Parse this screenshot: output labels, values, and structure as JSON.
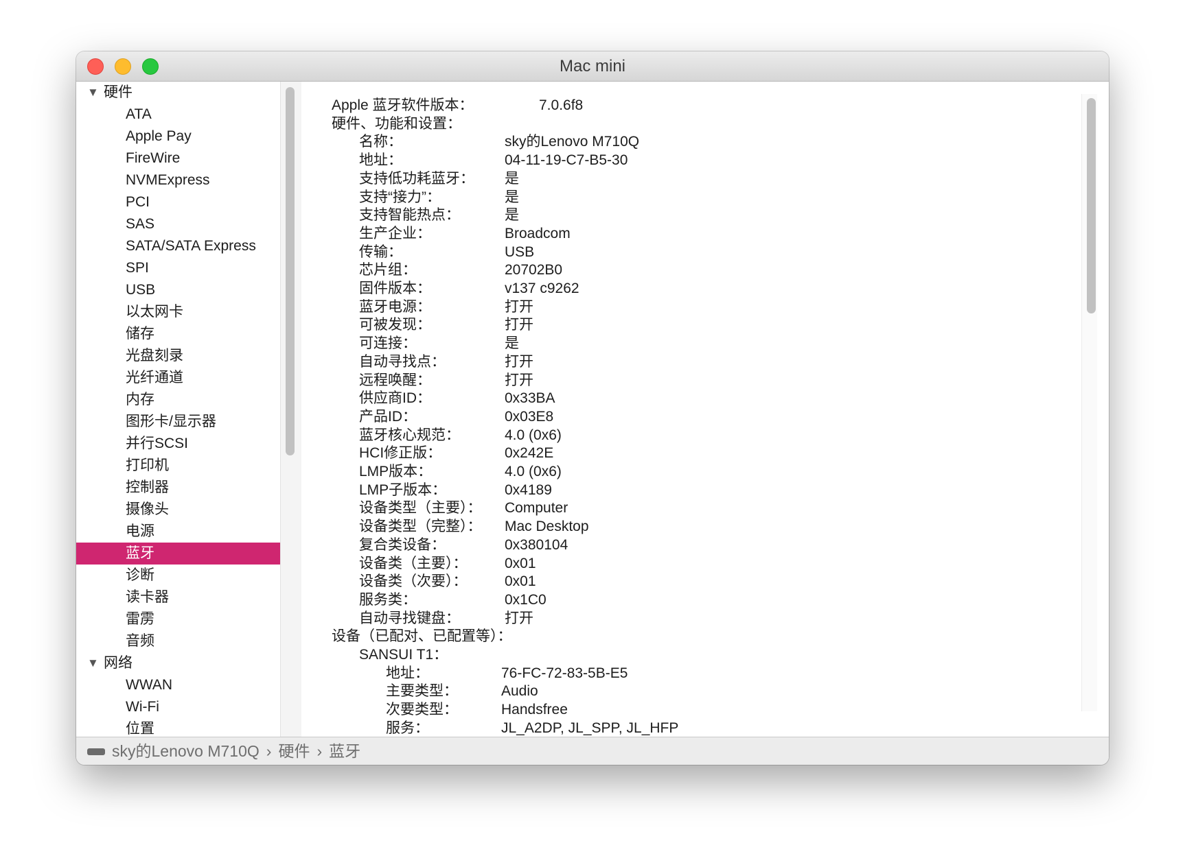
{
  "window": {
    "title": "Mac mini",
    "traffic_lights": {
      "close": "#fe5f57",
      "minimize": "#febc2e",
      "zoom": "#28c840"
    }
  },
  "accent_color": "#cf2670",
  "sidebar": {
    "items": [
      {
        "label": "硬件",
        "group": true,
        "icon": "disclosure-triangle-down"
      },
      {
        "label": "ATA"
      },
      {
        "label": "Apple Pay"
      },
      {
        "label": "FireWire"
      },
      {
        "label": "NVMExpress"
      },
      {
        "label": "PCI"
      },
      {
        "label": "SAS"
      },
      {
        "label": "SATA/SATA Express"
      },
      {
        "label": "SPI"
      },
      {
        "label": "USB"
      },
      {
        "label": "以太网卡"
      },
      {
        "label": "储存"
      },
      {
        "label": "光盘刻录"
      },
      {
        "label": "光纤通道"
      },
      {
        "label": "内存"
      },
      {
        "label": "图形卡/显示器"
      },
      {
        "label": "并行SCSI"
      },
      {
        "label": "打印机"
      },
      {
        "label": "控制器"
      },
      {
        "label": "摄像头"
      },
      {
        "label": "电源"
      },
      {
        "label": "蓝牙",
        "selected": true
      },
      {
        "label": "诊断"
      },
      {
        "label": "读卡器"
      },
      {
        "label": "雷雳"
      },
      {
        "label": "音频"
      },
      {
        "label": "网络",
        "group": true,
        "icon": "disclosure-triangle-down"
      },
      {
        "label": "WWAN"
      },
      {
        "label": "Wi-Fi"
      },
      {
        "label": "位置"
      }
    ]
  },
  "content": {
    "rows": [
      {
        "level": 0,
        "label": "Apple 蓝牙软件版本：",
        "value": "7.0.6f8",
        "wide": true
      },
      {
        "level": 0,
        "label": "硬件、功能和设置：",
        "value": ""
      },
      {
        "level": 1,
        "label": "名称：",
        "value": "sky的Lenovo M710Q"
      },
      {
        "level": 1,
        "label": "地址：",
        "value": "04-11-19-C7-B5-30"
      },
      {
        "level": 1,
        "label": "支持低功耗蓝牙：",
        "value": "是"
      },
      {
        "level": 1,
        "label": "支持“接力”：",
        "value": "是"
      },
      {
        "level": 1,
        "label": "支持智能热点：",
        "value": "是"
      },
      {
        "level": 1,
        "label": "生产企业：",
        "value": "Broadcom"
      },
      {
        "level": 1,
        "label": "传输：",
        "value": "USB"
      },
      {
        "level": 1,
        "label": "芯片组：",
        "value": "20702B0"
      },
      {
        "level": 1,
        "label": "固件版本：",
        "value": "v137 c9262"
      },
      {
        "level": 1,
        "label": "蓝牙电源：",
        "value": "打开"
      },
      {
        "level": 1,
        "label": "可被发现：",
        "value": "打开"
      },
      {
        "level": 1,
        "label": "可连接：",
        "value": "是"
      },
      {
        "level": 1,
        "label": "自动寻找点：",
        "value": "打开"
      },
      {
        "level": 1,
        "label": "远程唤醒：",
        "value": "打开"
      },
      {
        "level": 1,
        "label": "供应商ID：",
        "value": "0x33BA"
      },
      {
        "level": 1,
        "label": "产品ID：",
        "value": "0x03E8"
      },
      {
        "level": 1,
        "label": "蓝牙核心规范：",
        "value": "4.0 (0x6)"
      },
      {
        "level": 1,
        "label": "HCI修正版：",
        "value": "0x242E"
      },
      {
        "level": 1,
        "label": "LMP版本：",
        "value": "4.0 (0x6)"
      },
      {
        "level": 1,
        "label": "LMP子版本：",
        "value": "0x4189"
      },
      {
        "level": 1,
        "label": "设备类型（主要）：",
        "value": "Computer"
      },
      {
        "level": 1,
        "label": "设备类型（完整）：",
        "value": "Mac Desktop"
      },
      {
        "level": 1,
        "label": "复合类设备：",
        "value": "0x380104"
      },
      {
        "level": 1,
        "label": "设备类（主要）：",
        "value": "0x01"
      },
      {
        "level": 1,
        "label": "设备类（次要）：",
        "value": "0x01"
      },
      {
        "level": 1,
        "label": "服务类：",
        "value": "0x1C0"
      },
      {
        "level": 1,
        "label": "自动寻找键盘：",
        "value": "打开"
      },
      {
        "level": 0,
        "label": "设备（已配对、已配置等）：",
        "value": ""
      },
      {
        "level": 1,
        "label": "SANSUI T1：",
        "value": ""
      },
      {
        "level": 2,
        "label": "地址：",
        "value": "76-FC-72-83-5B-E5"
      },
      {
        "level": 2,
        "label": "主要类型：",
        "value": "Audio"
      },
      {
        "level": 2,
        "label": "次要类型：",
        "value": "Handsfree"
      },
      {
        "level": 2,
        "label": "服务：",
        "value": "JL_A2DP, JL_SPP, JL_HFP"
      }
    ]
  },
  "footer": {
    "icon": "drive-icon",
    "breadcrumb": [
      "sky的Lenovo M710Q",
      "硬件",
      "蓝牙"
    ],
    "separator": "›"
  }
}
